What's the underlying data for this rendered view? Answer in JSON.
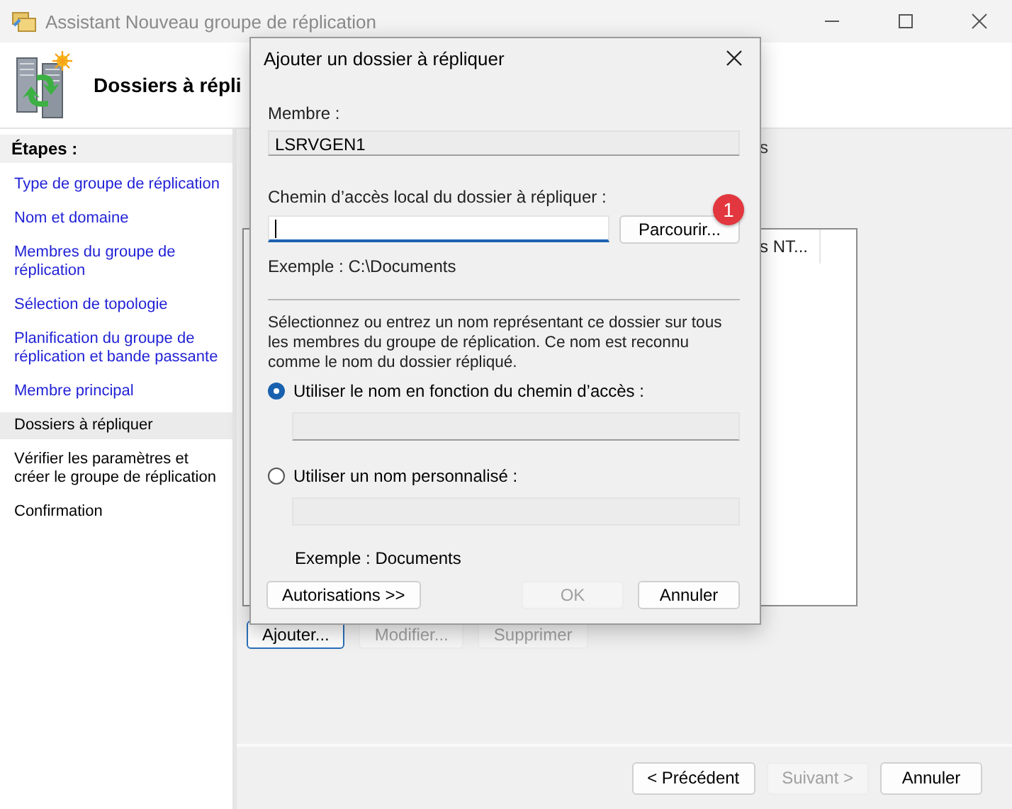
{
  "window": {
    "title": "Assistant Nouveau groupe de réplication"
  },
  "header": {
    "title": "Dossiers à répli"
  },
  "steps": {
    "heading": "Étapes :",
    "items": [
      {
        "label": "Type de groupe de réplication",
        "link": true,
        "selected": false
      },
      {
        "label": "Nom et domaine",
        "link": true,
        "selected": false
      },
      {
        "label": "Membres du groupe de réplication",
        "link": true,
        "selected": false
      },
      {
        "label": "Sélection de topologie",
        "link": true,
        "selected": false
      },
      {
        "label": "Planification du groupe de réplication et bande passante",
        "link": true,
        "selected": false
      },
      {
        "label": "Membre principal",
        "link": true,
        "selected": false
      },
      {
        "label": "Dossiers à répliquer",
        "link": false,
        "selected": true
      },
      {
        "label": "Vérifier les paramètres et créer le groupe de réplication",
        "link": false,
        "selected": false
      },
      {
        "label": "Confirmation",
        "link": false,
        "selected": false
      }
    ]
  },
  "content": {
    "label": "s",
    "list": {
      "column_1": "s NT..."
    },
    "buttons": [
      {
        "label": "Ajouter...",
        "disabled": false,
        "default": true
      },
      {
        "label": "Modifier...",
        "disabled": true,
        "default": false
      },
      {
        "label": "Supprimer",
        "disabled": true,
        "default": false
      }
    ]
  },
  "footer": {
    "buttons": [
      {
        "label": "< Précédent",
        "disabled": false
      },
      {
        "label": "Suivant >",
        "disabled": true
      },
      {
        "label": "Annuler",
        "disabled": false
      }
    ]
  },
  "dialog": {
    "title": "Ajouter un dossier à répliquer",
    "member_label": "Membre :",
    "member_field": {
      "value": "LSRVGEN1"
    },
    "path_label": "Chemin d’accès local du dossier à répliquer :",
    "path_field": {
      "focused": true
    },
    "browse_button": {
      "label": "Parcourir...",
      "badge": "1"
    },
    "path_example": "Exemple : C:\\Documents",
    "description": "Sélectionnez ou entrez un nom représentant ce dossier sur tous les membres du groupe de réplication. Ce nom est reconnu comme le nom du dossier répliqué.",
    "options": [
      {
        "label": "Utiliser le nom en fonction du chemin d’accès :",
        "selected": true
      },
      {
        "label": "Utiliser un nom personnalisé :",
        "selected": false
      }
    ],
    "name_example": "Exemple : Documents",
    "buttons": [
      {
        "label": "Autorisations >>",
        "disabled": false
      },
      {
        "label": "OK",
        "disabled": true
      },
      {
        "label": "Annuler",
        "disabled": false
      }
    ]
  }
}
